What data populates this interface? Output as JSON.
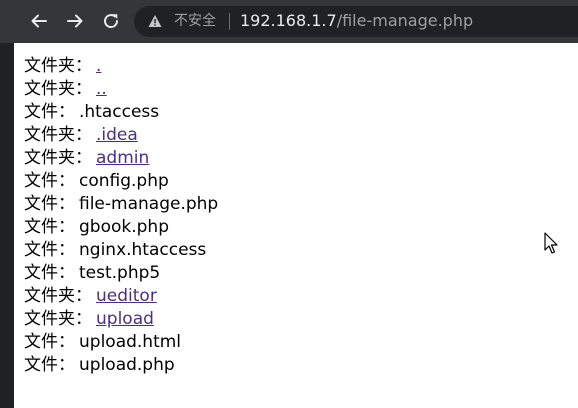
{
  "browser": {
    "security_label": "不安全",
    "url_host": "192.168.1.7",
    "url_path": "/file-manage.php"
  },
  "listing": {
    "entries": [
      {
        "type": "文件夹：",
        "name": ".",
        "is_link": true
      },
      {
        "type": "文件夹：",
        "name": "..",
        "is_link": true
      },
      {
        "type": "文件：",
        "name": ".htaccess",
        "is_link": false
      },
      {
        "type": "文件夹：",
        "name": ".idea",
        "is_link": true
      },
      {
        "type": "文件夹：",
        "name": "admin",
        "is_link": true
      },
      {
        "type": "文件：",
        "name": "config.php",
        "is_link": false
      },
      {
        "type": "文件：",
        "name": "file-manage.php",
        "is_link": false
      },
      {
        "type": "文件：",
        "name": "gbook.php",
        "is_link": false
      },
      {
        "type": "文件：",
        "name": "nginx.htaccess",
        "is_link": false
      },
      {
        "type": "文件：",
        "name": "test.php5",
        "is_link": false
      },
      {
        "type": "文件夹：",
        "name": "ueditor",
        "is_link": true
      },
      {
        "type": "文件夹：",
        "name": "upload",
        "is_link": true
      },
      {
        "type": "文件：",
        "name": "upload.html",
        "is_link": false
      },
      {
        "type": "文件：",
        "name": "upload.php",
        "is_link": false
      }
    ]
  },
  "icons": {
    "back": "arrow-left-icon",
    "forward": "arrow-right-icon",
    "reload": "reload-icon",
    "security": "warning-triangle-icon",
    "cursor": "mouse-pointer-icon"
  },
  "colors": {
    "toolbar_bg": "#35363a",
    "omnibox_bg": "#202124",
    "link_visited": "#4b2f86",
    "page_bg": "#ffffff"
  }
}
